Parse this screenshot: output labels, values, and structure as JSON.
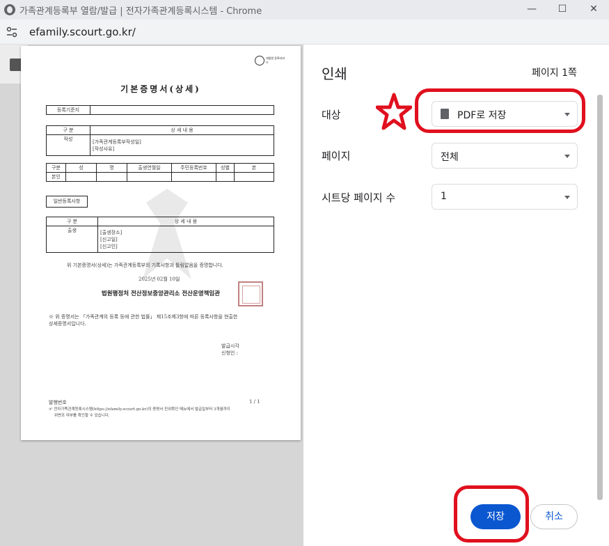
{
  "window": {
    "title": "가족관계등록부 열람/발급 | 전자가족관계등록시스템 - Chrome",
    "minimize": "—",
    "maximize": "☐",
    "close": "✕"
  },
  "address": {
    "url": "efamily.scourt.go.kr/"
  },
  "document": {
    "title": "기본증명서(상세)",
    "logo_text": "대법원 등록서비스",
    "row_reg_base": "등록기준지",
    "col_kind": "구 분",
    "col_detail": "상 세 내 용",
    "writing": "작성",
    "writing_1": "[가족관계등록부작성일]",
    "writing_2": "[작성사유]",
    "person_headers": [
      "구분",
      "성",
      "명",
      "출생연월일",
      "주민등록번호",
      "성별",
      "본"
    ],
    "person_row": "본인",
    "general": "일반등록사항",
    "birth": "출생",
    "birth_1": "[출생장소]",
    "birth_2": "[신고일]",
    "birth_3": "[신고인]",
    "cert_sentence": "위 기본증명서(상세)는 가족관계등록부의 기록사항과 틀림없음을 증명합니다.",
    "date": "2025년 02월 10일",
    "issuer": "법원행정처 전산정보중앙관리소 전산운영책임관",
    "note_1": "※ 위 증명서는 「가족관계의 등록 등에 관한 법률」 제15조제3항에 따른 등록사항을 현출한",
    "note_2": "상세증명서입니다.",
    "issue_time": "발급시각",
    "applicant": "신청인 :",
    "issue_no": "발행번호",
    "page_no": "1 / 1",
    "footer_1": "☞ 전자가족관계등록시스템(https://efamily.scourt.go.kr)의 증명서 진위확인 메뉴에서 발급일부터 3개월까지",
    "footer_2": "위변조 여부를 확인할 수 있습니다."
  },
  "print": {
    "title": "인쇄",
    "page_count": "페이지 1쪽",
    "destination_label": "대상",
    "destination_value": "PDF로 저장",
    "pages_label": "페이지",
    "pages_value": "전체",
    "per_sheet_label": "시트당 페이지 수",
    "per_sheet_value": "1",
    "save_button": "저장",
    "cancel_button": "취소"
  },
  "colors": {
    "accent": "#0b57d0",
    "annotation": "#e0101e"
  }
}
